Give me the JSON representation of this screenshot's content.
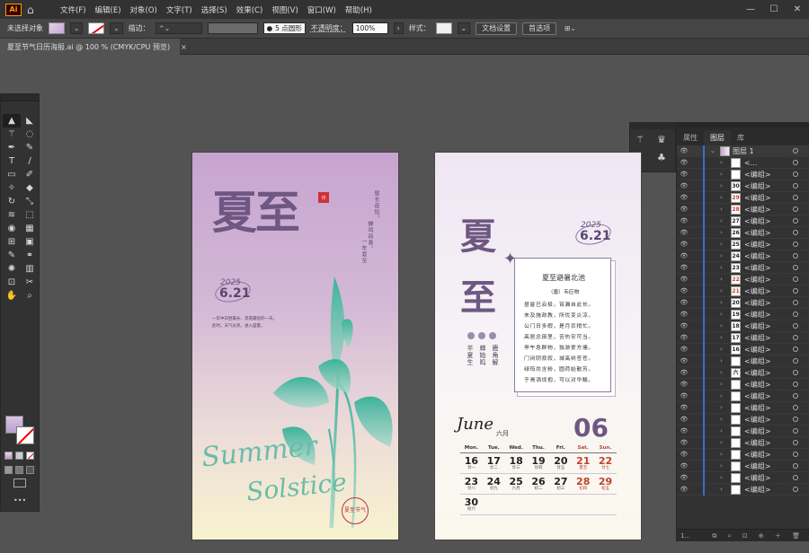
{
  "app": {
    "logo": "Ai",
    "home_icon": "home-icon"
  },
  "menu": [
    "文件(F)",
    "编辑(E)",
    "对象(O)",
    "文字(T)",
    "选择(S)",
    "效果(C)",
    "视图(V)",
    "窗口(W)",
    "帮助(H)"
  ],
  "window_controls": [
    "—",
    "☐",
    "✕"
  ],
  "control_bar": {
    "selection": "未选择对象",
    "stroke_label": "描边：",
    "brush": "5 点圆形",
    "opacity_label": "不透明度：",
    "opacity": "100%",
    "style_label": "样式：",
    "doc_settings": "文档设置",
    "preferences": "首选项"
  },
  "document_tab": {
    "title": "夏至节气日历海报.ai @ 100 % (CMYK/CPU 预览)",
    "close": "×"
  },
  "tools": [
    "selection-tool",
    "direct-selection-tool",
    "magic-wand-tool",
    "lasso-tool",
    "pen-tool",
    "curvature-tool",
    "type-tool",
    "line-tool",
    "rectangle-tool",
    "paintbrush-tool",
    "shaper-tool",
    "eraser-tool",
    "rotate-tool",
    "scale-tool",
    "width-tool",
    "free-transform-tool",
    "shape-builder-tool",
    "perspective-tool",
    "mesh-tool",
    "gradient-tool",
    "eyedropper-tool",
    "blend-tool",
    "symbol-sprayer-tool",
    "column-graph-tool",
    "artboard-tool",
    "slice-tool",
    "hand-tool",
    "zoom-tool"
  ],
  "toolbar_more": "•••",
  "layers_panel": {
    "tabs": [
      "属性",
      "图层",
      "库"
    ],
    "top_layer": "图层 1",
    "rows": [
      "<...",
      "<编组>",
      "<编组>",
      "<编组>",
      "<编组>",
      "<编组>",
      "<编组>",
      "<编组>",
      "<编组>",
      "<编组>",
      "<编组>",
      "<编组>",
      "<编组>",
      "<编组>",
      "<编组>",
      "<编组>",
      "<编组>",
      "<编组>",
      "<编组>",
      "<编组>",
      "<编组>",
      "<编组>",
      "<编组>",
      "<编组>",
      "<编组>",
      "<编组>",
      "<编组>",
      "<编组>",
      "<编组>"
    ],
    "thumbs": [
      "",
      "",
      "30",
      "29",
      "28",
      "27",
      "26",
      "25",
      "24",
      "23",
      "22",
      "21",
      "20",
      "19",
      "18",
      "17",
      "16",
      "",
      "六月",
      "",
      "",
      "",
      "",
      "",
      "",
      "",
      "",
      "",
      ""
    ],
    "footer": "1..."
  },
  "poster_left": {
    "title": "夏至",
    "vertical_poem": [
      "昼长夜短，",
      "蝉鸣荷香，",
      "一年夏至"
    ],
    "year": "2025",
    "date": "6.21",
    "desc": [
      "一年中白昼最长、黑夜最短的一天。",
      "此时，天气炎热，进入盛夏。"
    ],
    "script_1": "Summer",
    "script_2": "Solstice",
    "seal": "夏至节气",
    "seal_small": "印"
  },
  "poster_right": {
    "title_1": "夏",
    "title_2": "至",
    "year": "2025",
    "date": "6.21",
    "phenology": [
      "鹿",
      "角",
      "解",
      "蝉",
      "始",
      "鸣",
      "半",
      "夏",
      "生"
    ],
    "phenology_cols": [
      "鹿角解",
      "蝉始鸣",
      "半夏生"
    ],
    "poem_title": "夏至避暑北池",
    "poem_author": "（唐）韦应物",
    "poem_lines": [
      "昼晷已云极，宵漏自此长。",
      "未及施政教，所忧变炎凉。",
      "公门日多暇，是月农稍忙。",
      "高居念田里，苦热安可当。",
      "亭午息群物，独游爱方塘。",
      "门闭阴寂寂，城高树苍苍。",
      "绿筠尚含粉，圆荷始散芳。",
      "于焉洒烦抱，可以对华觞。"
    ],
    "month_script": "June",
    "month_cn": "六月",
    "month_num": "06",
    "weekdays": [
      "Mon.",
      "Tue.",
      "Wed.",
      "Thu.",
      "Fri.",
      "Sat.",
      "Sun."
    ],
    "weeks": [
      [
        {
          "n": "16",
          "l": "廿一"
        },
        {
          "n": "17",
          "l": "廿二"
        },
        {
          "n": "18",
          "l": "廿三"
        },
        {
          "n": "19",
          "l": "廿四"
        },
        {
          "n": "20",
          "l": "廿五"
        },
        {
          "n": "21",
          "l": "夏至"
        },
        {
          "n": "22",
          "l": "廿七"
        }
      ],
      [
        {
          "n": "23",
          "l": "廿八"
        },
        {
          "n": "24",
          "l": "廿九"
        },
        {
          "n": "25",
          "l": "六月"
        },
        {
          "n": "26",
          "l": "初二"
        },
        {
          "n": "27",
          "l": "初三"
        },
        {
          "n": "28",
          "l": "初四"
        },
        {
          "n": "29",
          "l": "初五"
        }
      ],
      [
        {
          "n": "30",
          "l": "初六"
        }
      ]
    ],
    "accent_red": "#c2402f",
    "accent_purple": "#6e5782"
  }
}
